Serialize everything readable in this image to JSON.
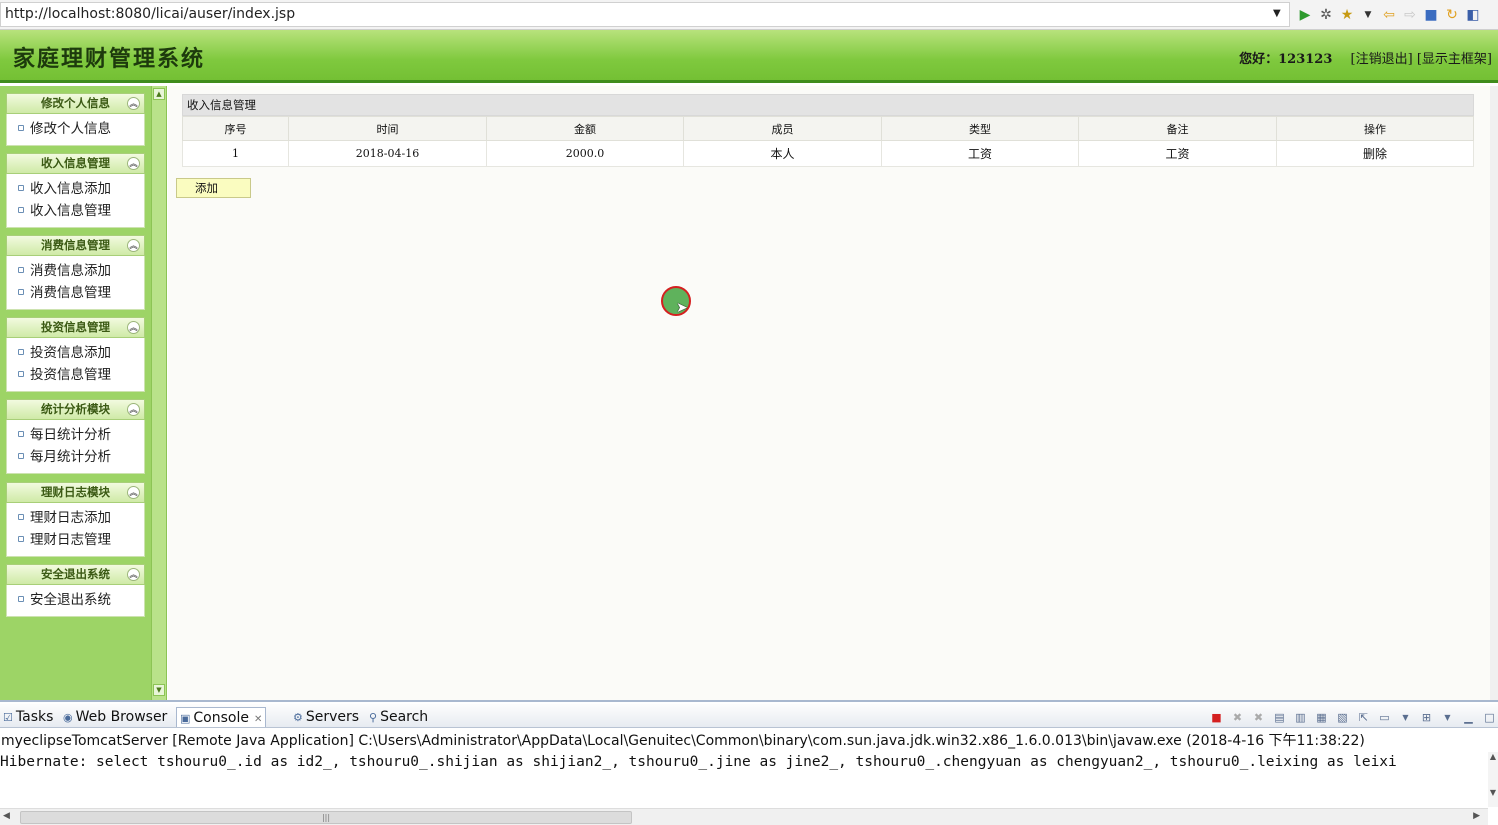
{
  "browser": {
    "url": "http://localhost:8080/licai/auser/index.jsp",
    "icons": [
      "play-icon",
      "debug-icon",
      "favorite-icon",
      "back-icon",
      "forward-icon",
      "stop-icon",
      "refresh-icon",
      "app-icon"
    ]
  },
  "header": {
    "title": "家庭理财管理系统",
    "greeting": "您好：123123",
    "logout": "[注销退出]",
    "show_frame": "[显示主框架]"
  },
  "sidebar": {
    "groups": [
      {
        "title": "修改个人信息",
        "items": [
          "修改个人信息"
        ]
      },
      {
        "title": "收入信息管理",
        "items": [
          "收入信息添加",
          "收入信息管理"
        ]
      },
      {
        "title": "消费信息管理",
        "items": [
          "消费信息添加",
          "消费信息管理"
        ]
      },
      {
        "title": "投资信息管理",
        "items": [
          "投资信息添加",
          "投资信息管理"
        ]
      },
      {
        "title": "统计分析模块",
        "items": [
          "每日统计分析",
          "每月统计分析"
        ]
      },
      {
        "title": "理财日志模块",
        "items": [
          "理财日志添加",
          "理财日志管理"
        ]
      },
      {
        "title": "安全退出系统",
        "items": [
          "安全退出系统"
        ]
      }
    ]
  },
  "main": {
    "panel_title": "收入信息管理",
    "columns": [
      "序号",
      "时间",
      "金额",
      "成员",
      "类型",
      "备注",
      "操作"
    ],
    "rows": [
      {
        "no": "1",
        "time": "2018-04-16",
        "amount": "2000.0",
        "member": "本人",
        "type": "工资",
        "note": "工资",
        "action": "删除"
      }
    ],
    "add_label": "添加"
  },
  "ide": {
    "tabs": [
      "Tasks",
      "Web Browser",
      "Console",
      "Servers",
      "Search"
    ],
    "active_tab": "Console",
    "status": "myeclipseTomcatServer [Remote Java Application] C:\\Users\\Administrator\\AppData\\Local\\Genuitec\\Common\\binary\\com.sun.java.jdk.win32.x86_1.6.0.013\\bin\\javaw.exe (2018-4-16 下午11:38:22)",
    "console_line": "Hibernate: select tshouru0_.id as id2_, tshouru0_.shijian as shijian2_, tshouru0_.jine as jine2_, tshouru0_.chengyuan as chengyuan2_, tshouru0_.leixing as leixi"
  },
  "colors": {
    "header_green": "#7fc93e",
    "sidebar_green": "#9dd466",
    "title_text": "#1d3a0d",
    "add_button": "#fafcc0",
    "cursor_ring": "#d42020"
  }
}
